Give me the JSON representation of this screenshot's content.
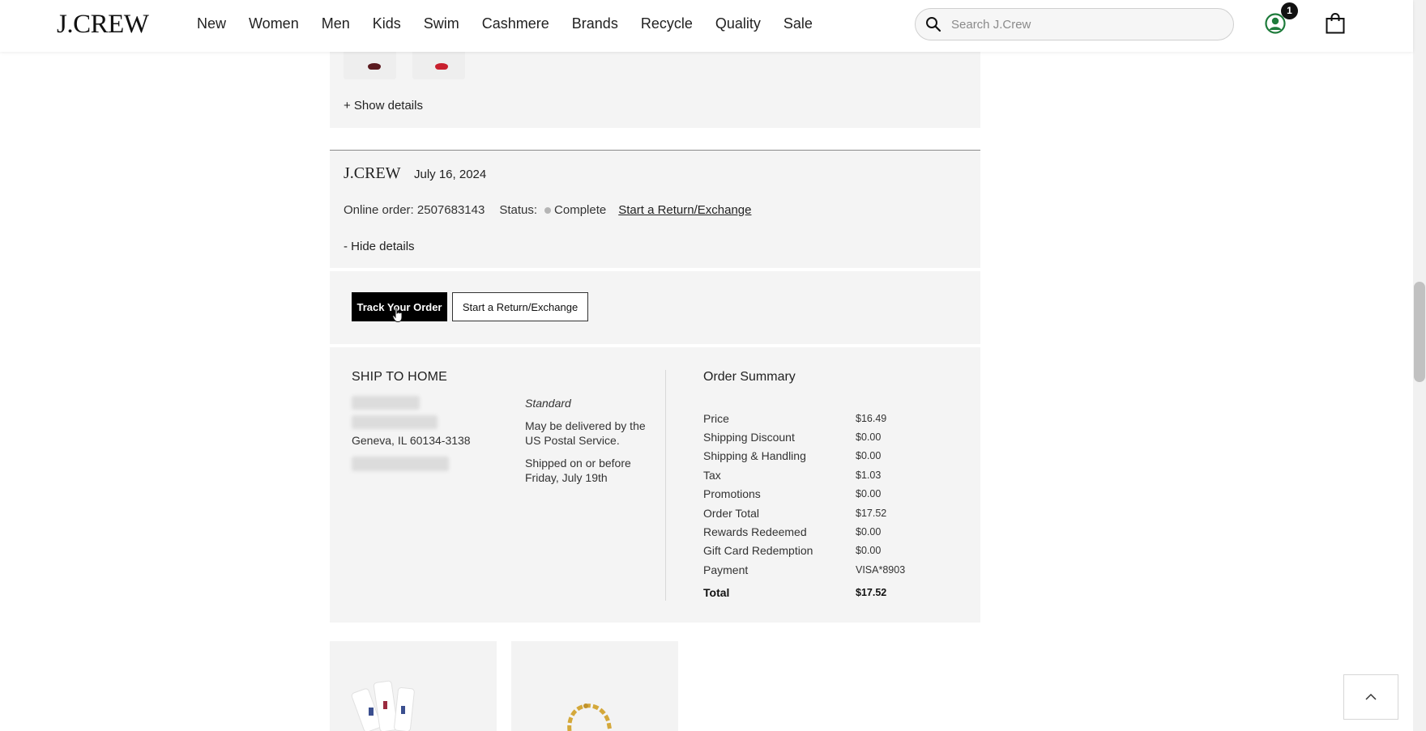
{
  "header": {
    "logo": "J.CREW",
    "nav": [
      "New",
      "Women",
      "Men",
      "Kids",
      "Swim",
      "Cashmere",
      "Brands",
      "Recycle",
      "Quality",
      "Sale"
    ],
    "search_placeholder": "Search J.Crew",
    "account_badge": "1",
    "icons": [
      "search-icon",
      "account-icon",
      "shopping-bag-icon"
    ]
  },
  "previous_order": {
    "show_details": "+ Show details"
  },
  "order": {
    "brand": "J.CREW",
    "date": "July 16, 2024",
    "online_order_label": "Online order:",
    "order_number": "2507683143",
    "status_label": "Status:",
    "status": "Complete",
    "status_color": "#b5b5b5",
    "return_link": "Start a Return/Exchange",
    "hide_details": "- Hide details",
    "track_button": "Track Your Order",
    "return_button": "Start a Return/Exchange"
  },
  "shipping": {
    "title": "SHIP TO HOME",
    "city_line": "Geneva, IL 60134-3138",
    "method": "Standard",
    "note1": "May be delivered by the US Postal Service.",
    "note2": "Shipped on or before Friday, July 19th"
  },
  "summary": {
    "title": "Order Summary",
    "rows": [
      {
        "label": "Price",
        "value": "$16.49"
      },
      {
        "label": "Shipping Discount",
        "value": "$0.00"
      },
      {
        "label": "Shipping & Handling",
        "value": "$0.00"
      },
      {
        "label": "Tax",
        "value": "$1.03"
      },
      {
        "label": "Promotions",
        "value": "$0.00"
      },
      {
        "label": "Order Total",
        "value": "$17.52"
      },
      {
        "label": "Rewards Redeemed",
        "value": "$0.00"
      },
      {
        "label": "Gift Card Redemption",
        "value": "$0.00"
      },
      {
        "label": "Payment",
        "value": "VISA*8903"
      }
    ],
    "total_label": "Total",
    "total_value": "$17.52"
  }
}
